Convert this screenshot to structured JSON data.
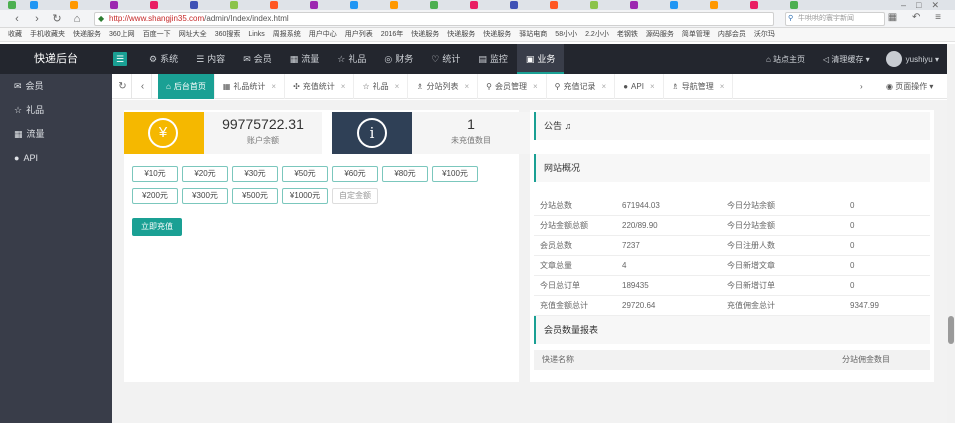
{
  "browser": {
    "address": {
      "url_host": "http://www.shangjin35.com",
      "url_path": "/admin/Index/index.html"
    },
    "search_placeholder": "牛哄哄的寰宇新闻",
    "bookmarks": [
      "收藏",
      "手机收藏夹",
      "快递服务",
      "360上网",
      "百度一下",
      "网址大全",
      "360搜索",
      "Links",
      "周报系统",
      "用户中心",
      "用户列表",
      "2016年",
      "快递服务",
      "快递服务",
      "快递服务",
      "驿站电商",
      "58小小",
      "2.2小小",
      "老钢铁",
      "源码服务",
      "简单管理",
      "内部会员",
      "沃尔玛"
    ]
  },
  "header": {
    "brand": "快递后台",
    "nav": [
      {
        "label": "系统",
        "icon": "gear-icon",
        "glyph": "⚙"
      },
      {
        "label": "内容",
        "icon": "list-icon",
        "glyph": "☰"
      },
      {
        "label": "会员",
        "icon": "user-icon",
        "glyph": "✉"
      },
      {
        "label": "流量",
        "icon": "chart-icon",
        "glyph": "▦"
      },
      {
        "label": "礼品",
        "icon": "gift-icon",
        "glyph": "☆"
      },
      {
        "label": "财务",
        "icon": "money-icon",
        "glyph": "◎"
      },
      {
        "label": "统计",
        "icon": "stats-icon",
        "glyph": "♡"
      },
      {
        "label": "监控",
        "icon": "monitor-icon",
        "glyph": "▤"
      },
      {
        "label": "业务",
        "icon": "business-icon",
        "glyph": "▣"
      }
    ],
    "active_nav": 8,
    "site_home": "站点主页",
    "clear_cache": "清理缓存",
    "username": "yushiyu"
  },
  "sidebar": [
    {
      "label": "会员",
      "glyph": "✉",
      "icon": "mail-icon"
    },
    {
      "label": "礼品",
      "glyph": "☆",
      "icon": "star-icon"
    },
    {
      "label": "流量",
      "glyph": "▦",
      "icon": "chart-icon"
    },
    {
      "label": "API",
      "glyph": "●",
      "icon": "api-icon"
    }
  ],
  "tabs": [
    {
      "label": "后台首页",
      "glyph": "⌂",
      "active": true
    },
    {
      "label": "礼品统计",
      "glyph": "▦"
    },
    {
      "label": "充值统计",
      "glyph": "✣"
    },
    {
      "label": "礼品",
      "glyph": "☆"
    },
    {
      "label": "分站列表",
      "glyph": "♗"
    },
    {
      "label": "会员管理",
      "glyph": "⚲"
    },
    {
      "label": "充值记录",
      "glyph": "⚲"
    },
    {
      "label": "API",
      "glyph": "●"
    },
    {
      "label": "导航管理",
      "glyph": "♗"
    }
  ],
  "page_ops": "页面操作",
  "balance": {
    "value": "99775722.31",
    "label": "账户余额"
  },
  "pending": {
    "value": "1",
    "label": "未充值数目"
  },
  "amounts": [
    "¥10元",
    "¥20元",
    "¥30元",
    "¥50元",
    "¥60元",
    "¥80元",
    "¥100元",
    "¥200元",
    "¥300元",
    "¥500元",
    "¥1000元"
  ],
  "custom_amount_placeholder": "自定金额",
  "recharge_button": "立即充值",
  "notice_title": "公告",
  "site_overview_title": "网站概况",
  "site_overview": [
    [
      "分站总数",
      "671944.03",
      "今日分站余额",
      "0"
    ],
    [
      "分站金额总额",
      "220/89.90",
      "今日分站金额",
      "0"
    ],
    [
      "会员总数",
      "7237",
      "今日注册人数",
      "0"
    ],
    [
      "文章总量",
      "4",
      "今日新增文章",
      "0"
    ],
    [
      "今日总订单",
      "189435",
      "今日新增订单",
      "0"
    ],
    [
      "充值金额总计",
      "29720.64",
      "充值佣金总计",
      "9347.99"
    ]
  ],
  "member_report_title": "会员数量报表",
  "member_report_headers": [
    "快递名称",
    "分站佣金数目"
  ]
}
